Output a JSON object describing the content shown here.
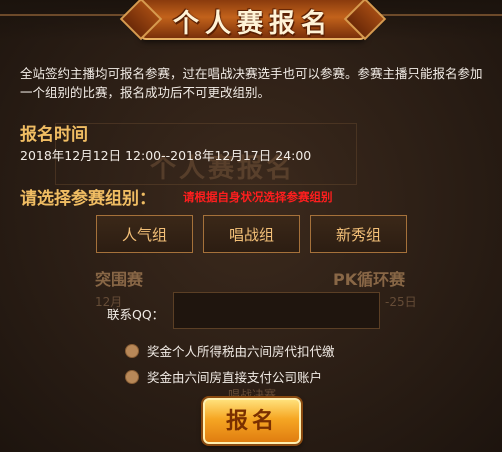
{
  "header": {
    "title": "个人赛报名"
  },
  "intro": "全站签约主播均可报名参赛，过在唱战决赛选手也可以参赛。参赛主播只能报名参加一个组别的比赛，报名成功后不可更改组别。",
  "time_section": {
    "title": "报名时间",
    "range": "2018年12月12日 12:00--2018年12月17日 24:00"
  },
  "group_section": {
    "title": "请选择参赛组别：",
    "hint": "请根据自身状况选择参赛组别",
    "buttons": [
      "人气组",
      "唱战组",
      "新秀组"
    ]
  },
  "background_text": {
    "watermark_title": "个人赛报名",
    "left_label": "突围赛",
    "left_date": "12月",
    "right_label": "PK循环赛",
    "right_date": "-25日",
    "mid": "唱战决赛"
  },
  "form": {
    "qq_label": "联系QQ：",
    "qq_value": "",
    "options": [
      "奖金个人所得税由六间房代扣代缴",
      "奖金由六间房直接支付公司账户"
    ]
  },
  "submit_label": "报名",
  "colors": {
    "accent": "#f0bd63",
    "hint": "#ff1e1e",
    "button_text": "#f3c078",
    "submit": "#f6a623"
  }
}
